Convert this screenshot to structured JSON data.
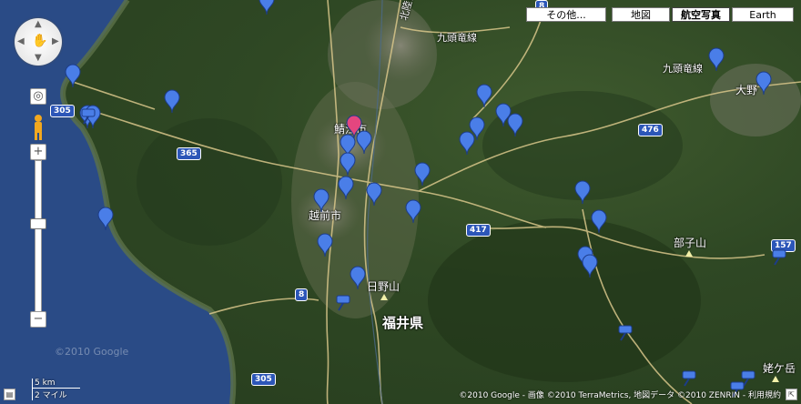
{
  "map_types": {
    "more": "その他...",
    "map": "地図",
    "satellite": "航空写真",
    "earth": "Earth",
    "active": "satellite"
  },
  "labels": {
    "sabae": "鯖江市",
    "echizen": "越前市",
    "fukui_pref": "福井県",
    "hinosan": "日野山",
    "hebukosan": "部子山",
    "ono": "大野",
    "kuzuryu": "九頭竜線",
    "hokuriku": "北陸自動車道",
    "kuzuryu_right": "九頭竜線",
    "mitake": "姥ケ岳"
  },
  "shields": {
    "r305_top": "305",
    "r365": "365",
    "r476": "476",
    "r417": "417",
    "r8": "8",
    "r157": "157",
    "r305_bottom": "305",
    "r8_top": "8"
  },
  "scale": {
    "km": "5 km",
    "mile": "2 マイル"
  },
  "copyright": "©2010 Google - 画像 ©2010 TerraMetrics, 地図データ ©2010 ZENRIN - 利用規約",
  "watermark": "©2010 Google",
  "colors": {
    "sea": "#2a4b86",
    "marker_blue": "#4a7ee8",
    "marker_red": "#e4467f",
    "road": "#d8c68a"
  },
  "markers": [
    {
      "type": "blue"
    },
    {
      "type": "blue"
    },
    {
      "type": "blue"
    },
    {
      "type": "blue"
    },
    {
      "type": "blue"
    },
    {
      "type": "blue"
    },
    {
      "type": "blue"
    },
    {
      "type": "blue"
    },
    {
      "type": "blue"
    },
    {
      "type": "blue"
    },
    {
      "type": "blue"
    },
    {
      "type": "blue"
    },
    {
      "type": "blue"
    },
    {
      "type": "blue"
    },
    {
      "type": "blue"
    },
    {
      "type": "blue"
    },
    {
      "type": "blue"
    },
    {
      "type": "blue"
    },
    {
      "type": "blue"
    },
    {
      "type": "blue"
    },
    {
      "type": "blue"
    },
    {
      "type": "blue"
    },
    {
      "type": "blue"
    },
    {
      "type": "blue"
    },
    {
      "type": "blue"
    },
    {
      "type": "blue"
    },
    {
      "type": "blue"
    },
    {
      "type": "red"
    }
  ],
  "pushpins": 7,
  "icons": {
    "pan": "pan-control-icon",
    "pegman": "pegman-icon",
    "zoom_in": "plus-icon",
    "zoom_out": "minus-icon",
    "overview": "overview-toggle-icon",
    "attribution": "map-data-icon"
  }
}
